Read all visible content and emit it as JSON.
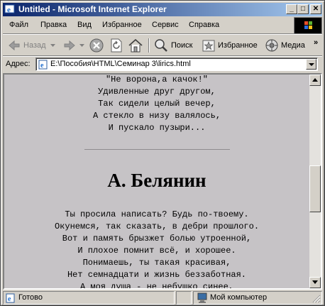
{
  "window": {
    "title": "Untitled - Microsoft Internet Explorer",
    "minimize": "_",
    "maximize": "□",
    "close": "✕"
  },
  "menu": [
    "Файл",
    "Правка",
    "Вид",
    "Избранное",
    "Сервис",
    "Справка"
  ],
  "toolbar": {
    "back": "Назад",
    "search": "Поиск",
    "favorites": "Избранное",
    "media": "Медиа",
    "overflow": "»"
  },
  "address": {
    "label": "Адрес:",
    "value": "E:\\Пособия\\HTML\\Семинар 3\\lirics.html"
  },
  "content": {
    "poem1": [
      "\"Не ворона,а качок!\"",
      "Удивленные друг другом,",
      "Так сидели целый вечер,",
      "А стекло в низу валялось,",
      "И пускало пузыри..."
    ],
    "author": "А. Белянин",
    "poem2": [
      "Ты просила написать? Будь по-твоему.",
      "Окунемся, так сказать, в дебри прошлого.",
      "Вот и память брызжет болью утроенной,",
      "И плохое помнит всё, и хорошее.",
      "Понимаешь, ты такая красивая,",
      "Нет семнадцати и жизнь беззаботная.",
      "А моя душа - не небушко синее,"
    ]
  },
  "status": {
    "text": "Готово",
    "zone": "Мой компьютер"
  },
  "colors": {
    "page_background": "#c6c3c6",
    "titlebar_start": "#0a246a",
    "titlebar_end": "#a6caf0"
  }
}
